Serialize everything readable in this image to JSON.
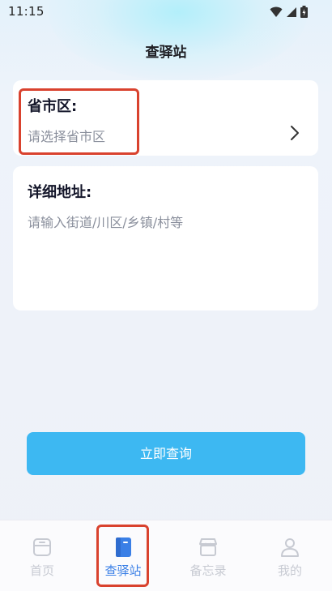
{
  "status_bar": {
    "time": "11:15",
    "icons": [
      "wifi-icon",
      "cell-signal-icon",
      "battery-icon"
    ]
  },
  "header": {
    "title": "查驿站"
  },
  "region_card": {
    "label": "省市区:",
    "placeholder": "请选择省市区",
    "icon": "chevron-right-icon"
  },
  "address_card": {
    "label": "详细地址:",
    "placeholder": "请输入街道/川区/乡镇/村等"
  },
  "query_button": {
    "label": "立即查询"
  },
  "tabbar": {
    "tabs": [
      {
        "label": "首页",
        "icon": "home-box-icon",
        "active": false
      },
      {
        "label": "查驿站",
        "icon": "book-icon",
        "active": true
      },
      {
        "label": "备忘录",
        "icon": "store-icon",
        "active": false
      },
      {
        "label": "我的",
        "icon": "user-icon",
        "active": false
      }
    ]
  },
  "colors": {
    "accent": "#3db8f2",
    "active_tab": "#3a7fe6",
    "inactive_tab": "#c7cad2",
    "highlight_box": "#d9422e"
  }
}
